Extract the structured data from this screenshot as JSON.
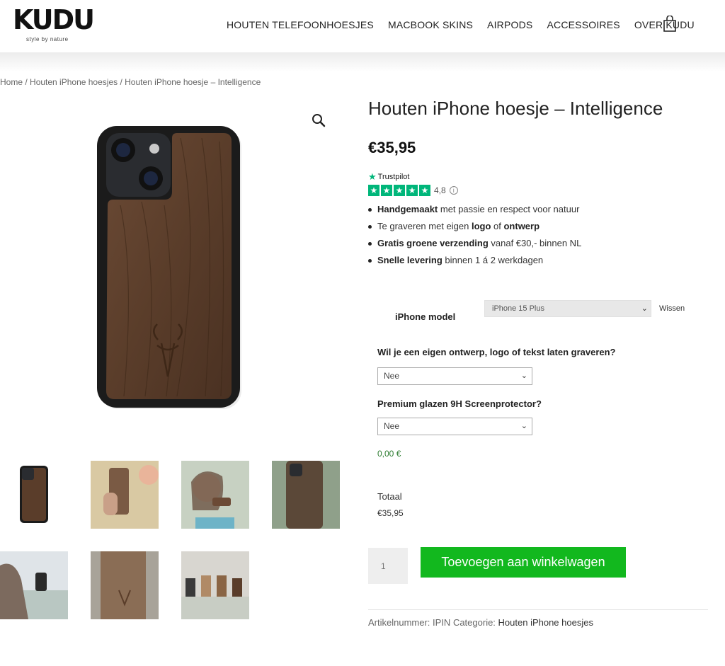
{
  "header": {
    "logo_word": "KUDU",
    "logo_tagline": "style by nature",
    "nav": [
      "HOUTEN TELEFOONHOESJES",
      "MACBOOK SKINS",
      "AIRPODS",
      "ACCESSOIRES",
      "OVER KUDU"
    ],
    "cart_icon": "shopping-bag-icon"
  },
  "breadcrumb": {
    "home": "Home",
    "sep1": " / ",
    "category": "Houten iPhone hoesjes",
    "sep2": " / ",
    "current": "Houten iPhone hoesje – Intelligence"
  },
  "product": {
    "title": "Houten iPhone hoesje – Intelligence",
    "price": "€35,95",
    "trustpilot": {
      "label": "Trustpilot",
      "score": "4,8",
      "stars": 5,
      "star_color": "#00b67a"
    },
    "features": [
      {
        "bold": "Handgemaakt",
        "rest": " met passie en respect voor natuur"
      },
      {
        "pre": "Te graveren met eigen ",
        "bold1": "logo",
        "mid": " of ",
        "bold2": "ontwerp"
      },
      {
        "bold": "Gratis groene verzending",
        "rest": " vanaf €30,- binnen NL"
      },
      {
        "bold": "Snelle levering",
        "rest": " binnen 1 á 2 werkdagen"
      }
    ],
    "model_label": "iPhone model",
    "model_selected": "iPhone 15 Plus",
    "clear_label": "Wissen",
    "engrave_question": "Wil je een eigen ontwerp, logo of tekst laten graveren?",
    "engrave_value": "Nee",
    "screen_question": "Premium glazen 9H Screenprotector?",
    "screen_value": "Nee",
    "addon_price": "0,00 €",
    "total_label": "Totaal",
    "total_value": "€35,95",
    "quantity": "1",
    "add_to_cart": "Toevoegen aan winkelwagen",
    "button_color": "#12b81e",
    "sku_label": "Artikelnummer: ",
    "sku": "IPIN",
    "category_label": " Categorie: ",
    "category": "Houten iPhone hoesjes"
  },
  "gallery": {
    "zoom_icon": "magnifier-icon",
    "thumbnail_count": 7
  }
}
